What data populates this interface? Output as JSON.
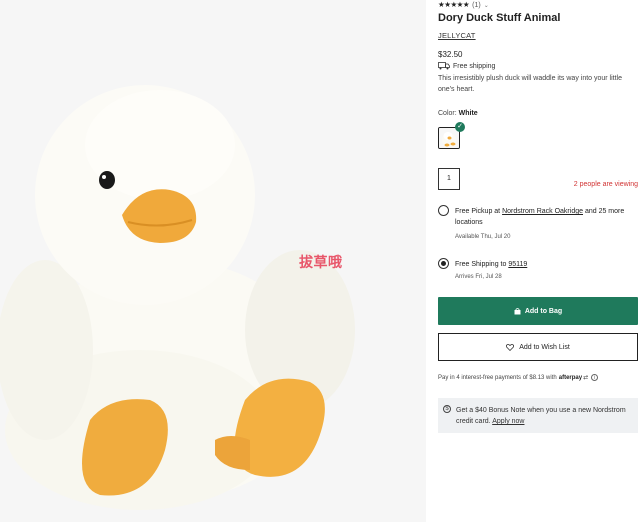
{
  "product": {
    "rating_stars": "★★★★★",
    "review_count": "(1)",
    "title": "Dory Duck Stuff Animal",
    "brand": "JELLYCAT",
    "price": "$32.50",
    "free_shipping": "Free shipping",
    "description": "This irresistibly plush duck will waddle its way into your little one's heart."
  },
  "image": {
    "alt": "Dory Duck Stuff Animal",
    "watermark": "拔草哦"
  },
  "color": {
    "label": "Color:",
    "value": "White"
  },
  "quantity": "1",
  "viewing": "2 people are viewing",
  "fulfillment": {
    "pickup": {
      "prefix": "Free Pickup at ",
      "store": "Nordstrom Rack Oakridge",
      "suffix": " and 25 more locations",
      "available": "Available Thu, Jul 20",
      "selected": false
    },
    "ship": {
      "prefix": "Free Shipping to ",
      "zip": "95119",
      "arrives": "Arrives Fri, Jul 28",
      "selected": true
    }
  },
  "buttons": {
    "add_to_bag": "Add to Bag",
    "add_to_wishlist": "Add to Wish List"
  },
  "afterpay": {
    "text": "Pay in 4 interest-free payments of $8.13 with",
    "brand": "afterpay"
  },
  "promo": {
    "text": "Get a $40 Bonus Note when you use a new Nordstrom credit card.",
    "link": "Apply now"
  },
  "colors": {
    "accent": "#1f7a5c",
    "alert": "#d13434",
    "promo_bg": "#eff1f3"
  },
  "icons": [
    "chevron-down-icon",
    "truck-icon",
    "check-icon",
    "bag-icon",
    "heart-icon",
    "info-icon",
    "gift-icon"
  ]
}
